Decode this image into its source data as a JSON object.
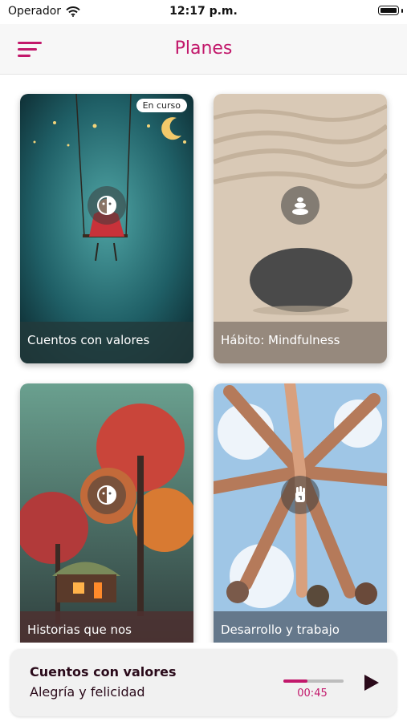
{
  "status_bar": {
    "carrier": "Operador",
    "time": "12:17 p.m."
  },
  "header": {
    "title": "Planes",
    "menu_icon": "hamburger-menu-icon"
  },
  "plans": [
    {
      "title": "Cuentos con valores",
      "badge": "En curso",
      "icon": "mask-icon"
    },
    {
      "title": "Hábito: Mindfulness",
      "icon": "stacked-stones-icon"
    },
    {
      "title": "Historias que nos",
      "icon": "mask-icon"
    },
    {
      "title": "Desarrollo y trabajo",
      "icon": "hand-icon"
    }
  ],
  "player": {
    "title": "Cuentos con valores",
    "subtitle": "Alegría y felicidad",
    "time": "00:45",
    "progress": 0.4
  },
  "colors": {
    "accent": "#c2186b"
  }
}
